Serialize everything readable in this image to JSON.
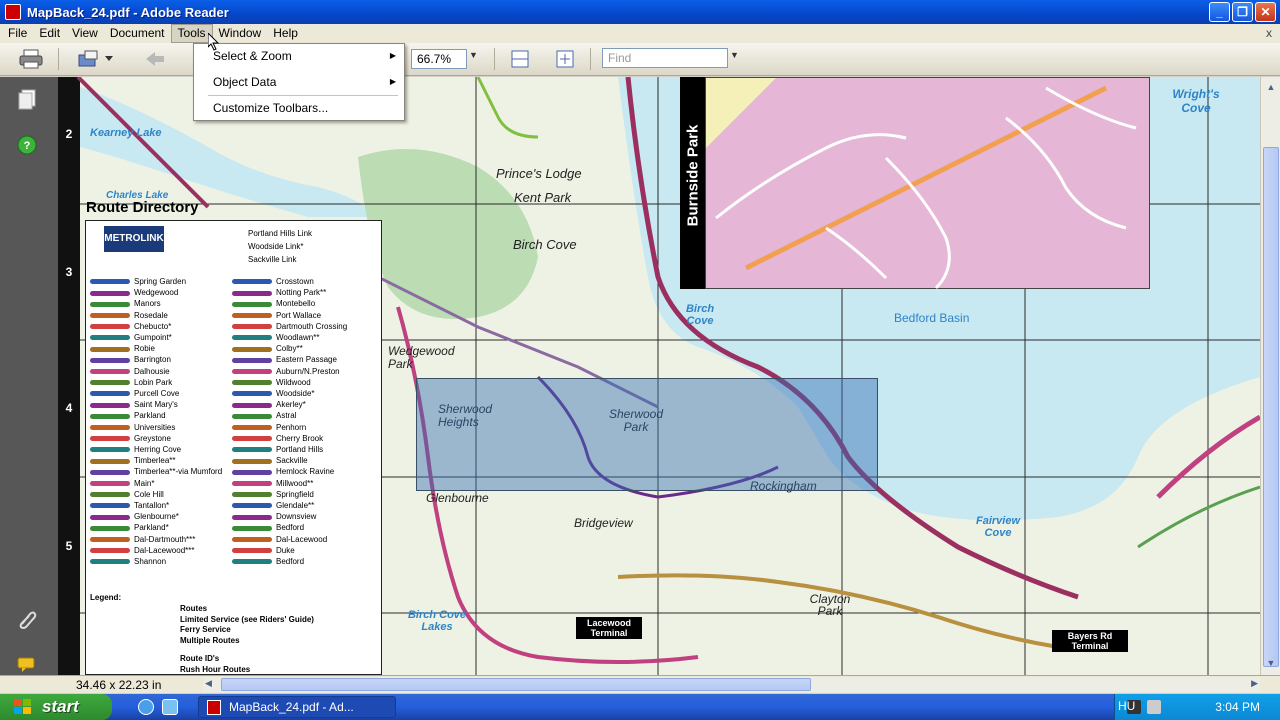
{
  "window": {
    "title": "MapBack_24.pdf - Adobe Reader"
  },
  "menubar": {
    "items": [
      "File",
      "Edit",
      "View",
      "Document",
      "Tools",
      "Window",
      "Help"
    ],
    "close_label": "x"
  },
  "toolbar": {
    "zoom_value": "66.7%",
    "find_placeholder": "Find"
  },
  "tools_menu": {
    "items": [
      {
        "label": "Select & Zoom",
        "has_submenu": true
      },
      {
        "label": "Object Data",
        "has_submenu": true
      },
      {
        "label": "Customize Toolbars...",
        "has_submenu": false
      }
    ]
  },
  "status": {
    "page_size": "34.46 x 22.23 in"
  },
  "taskbar": {
    "start_label": "start",
    "task_label": "MapBack_24.pdf - Ad...",
    "language": "HU",
    "clock": "3:04 PM"
  },
  "map": {
    "grid_numbers": [
      "2",
      "3",
      "4",
      "5"
    ],
    "route_directory_title": "Route Directory",
    "inset_title": "Burnside Park",
    "water_labels": [
      "Kearney Lake",
      "Charles Lake",
      "Birch Cove",
      "Bedford Basin",
      "Wright's Cove",
      "Fairview Cove",
      "Birch Cove Lakes"
    ],
    "land_labels": [
      "Prince's Lodge",
      "Kent Park",
      "Birch Cove",
      "Wedgewood Park",
      "Sherwood Heights",
      "Sherwood Park",
      "Rockingham",
      "Glenbourne",
      "Bridgeview",
      "Clayton Park"
    ],
    "terminals": [
      "Lacewood Terminal",
      "Bayers Rd Terminal"
    ],
    "legend_title": "Legend:",
    "legend_items": [
      "Routes",
      "Limited Service (see Riders' Guide)",
      "Ferry Service",
      "Multiple Routes",
      "Route ID's",
      "Rush Hour Routes"
    ],
    "metrolink_label": "METROLINK",
    "metrolink_routes": [
      "Portland Hills Link",
      "Woodside Link*",
      "Sackville Link"
    ],
    "routes_col1": [
      "Spring Garden",
      "Wedgewood",
      "Manors",
      "Rosedale",
      "Chebucto*",
      "Gumpoint*",
      "Robie",
      "Barrington",
      "Dalhousie",
      "Lobin Park",
      "Purcell Cove",
      "Saint Mary's",
      "Parkland",
      "Universities",
      "Greystone",
      "Herring Cove",
      "Timberlea**",
      "Timberlea**-via Mumford",
      "Main*",
      "Cole Hill",
      "Tantallon*",
      "Glenbourne*",
      "Parkland*",
      "Dal-Dartmouth***",
      "Dal-Lacewood***",
      "Shannon"
    ],
    "routes_col2": [
      "Crosstown",
      "Notting Park**",
      "Montebello",
      "Port Wallace",
      "Dartmouth Crossing",
      "Woodlawn**",
      "Colby**",
      "Eastern Passage",
      "Auburn/N.Preston",
      "Wildwood",
      "Woodside*",
      "Akerley*",
      "Astral",
      "Penhorn",
      "Cherry Brook",
      "Portland Hills",
      "Sackville",
      "Hemlock Ravine",
      "Millwood**",
      "Springfield",
      "Glendale**",
      "Downsview",
      "Bedford",
      "Dal-Lacewood",
      "Duke",
      "Bedford"
    ]
  }
}
